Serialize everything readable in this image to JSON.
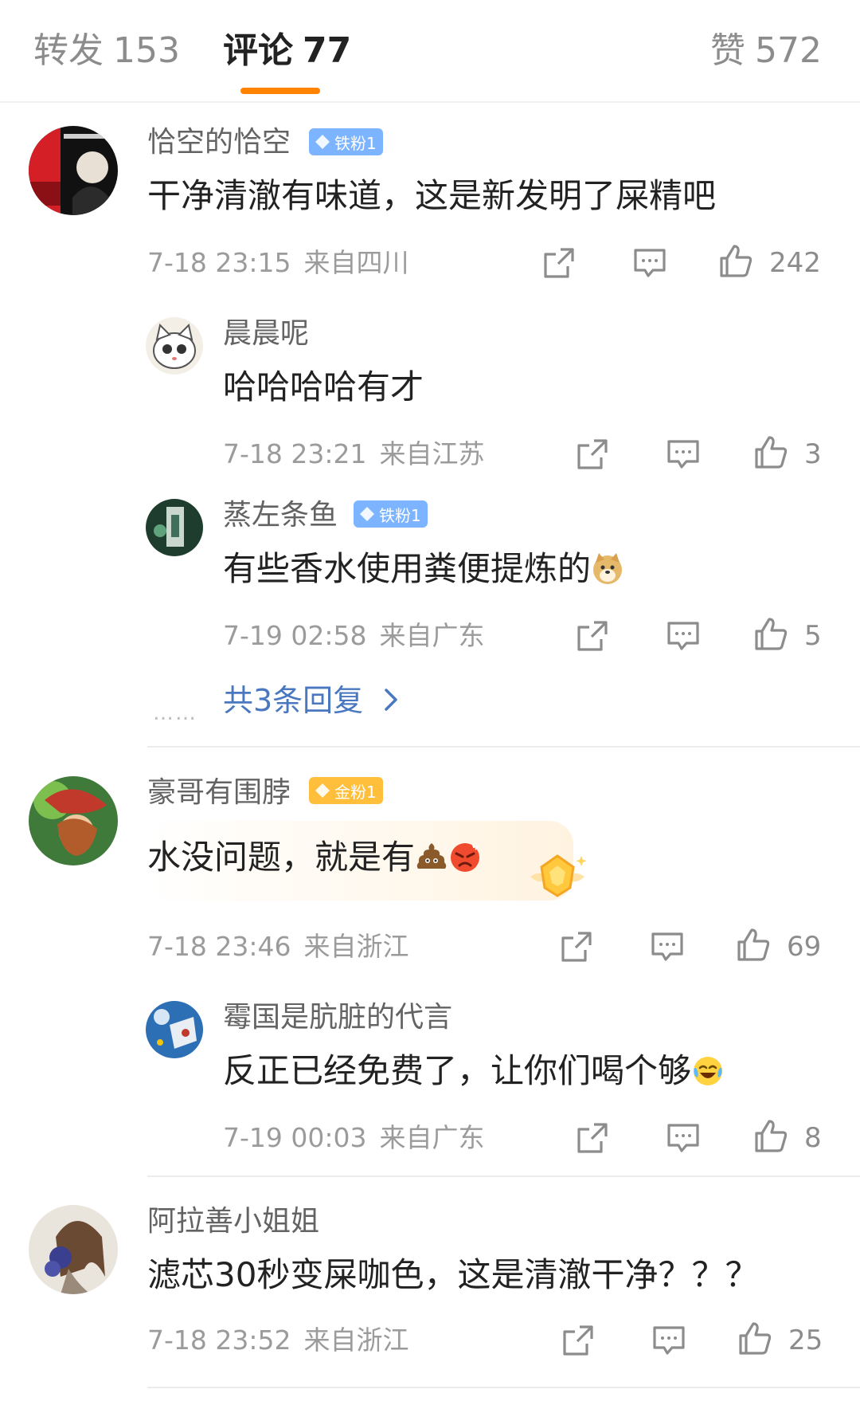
{
  "tabs": {
    "forward": {
      "label": "转发",
      "count": "153"
    },
    "comments": {
      "label": "评论",
      "count": "77"
    },
    "likes": {
      "label": "赞",
      "count": "572"
    }
  },
  "comments": [
    {
      "user": "恰空的恰空",
      "badge": "铁粉1",
      "text": "干净清澈有味道，这是新发明了屎精吧",
      "time": "7-18 23:15",
      "location": "来自四川",
      "likes": "242",
      "replies": [
        {
          "user": "晨晨呢",
          "text": "哈哈哈哈有才",
          "time": "7-18 23:21",
          "location": "来自江苏",
          "likes": "3"
        },
        {
          "user": "蒸左条鱼",
          "badge": "铁粉1",
          "text": "有些香水使用粪便提炼的",
          "time": "7-19 02:58",
          "location": "来自广东",
          "likes": "5"
        }
      ],
      "more_replies": "共3条回复",
      "more_dots": "……"
    },
    {
      "user": "豪哥有围脖",
      "badge": "金粉1",
      "text": "水没问题，就是有",
      "time": "7-18 23:46",
      "location": "来自浙江",
      "likes": "69",
      "replies": [
        {
          "user": "霉国是肮脏的代言",
          "text": "反正已经免费了，让你们喝个够",
          "time": "7-19 00:03",
          "location": "来自广东",
          "likes": "8"
        }
      ]
    },
    {
      "user": "阿拉善小姐姐",
      "text": "滤芯30秒变屎咖色，这是清澈干净？？？",
      "time": "7-18 23:52",
      "location": "来自浙江",
      "likes": "25"
    }
  ],
  "colors": {
    "accent": "#ff8200",
    "link": "#4a78c0",
    "iron_badge": "#7cb4ff",
    "gold_badge": "#ffbf3a"
  },
  "icons": [
    "share-icon",
    "comment-icon",
    "like-icon",
    "doge-emoji",
    "poop-emoji",
    "angry-emoji",
    "laugh-cry-emoji",
    "chevron-right-icon"
  ]
}
